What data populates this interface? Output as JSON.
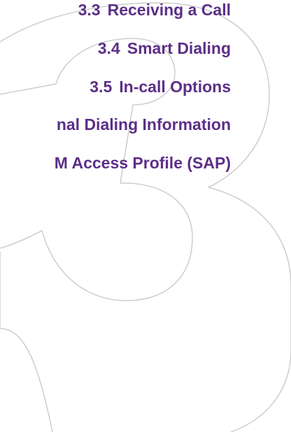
{
  "toc": {
    "entries": [
      {
        "number": "3.3",
        "title": "Receiving a Call"
      },
      {
        "number": "3.4",
        "title": "Smart Dialing"
      },
      {
        "number": "3.5",
        "title": "In-call Options"
      },
      {
        "number": "",
        "title": "nal Dialing Information"
      },
      {
        "number": "",
        "title": "M Access Profile (SAP)"
      }
    ]
  },
  "watermark": {
    "glyph": "3",
    "stroke_color": "#c6c6c6",
    "text_color": "#5c2f87"
  }
}
